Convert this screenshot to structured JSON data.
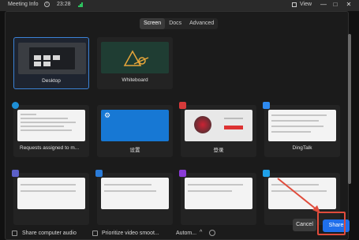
{
  "topbar": {
    "title": "Meeting Info",
    "info_glyph": "i",
    "time": "23:28",
    "view_label": "View",
    "min_glyph": "—",
    "max_glyph": "□",
    "close_glyph": "✕"
  },
  "tabs": [
    {
      "label": "Screen",
      "active": true
    },
    {
      "label": "Docs",
      "active": false
    },
    {
      "label": "Advanced",
      "active": false
    }
  ],
  "tiles": [
    {
      "label": "Desktop",
      "selected": true
    },
    {
      "label": "Whiteboard"
    },
    {
      "label": "Requests assigned to m..."
    },
    {
      "label": "设置"
    },
    {
      "label": "登录"
    },
    {
      "label": "DingTalk"
    },
    {
      "label": ""
    },
    {
      "label": ""
    },
    {
      "label": ""
    },
    {
      "label": ""
    }
  ],
  "bottom": {
    "share_audio": "Share computer audio",
    "prioritize_video": "Prioritize video smoot...",
    "automation": "Autom...",
    "cancel": "Cancel",
    "share": "Share"
  },
  "colors": {
    "accent": "#1f6feb",
    "selection": "#3b82d6",
    "highlight_red": "#e04c3c"
  }
}
